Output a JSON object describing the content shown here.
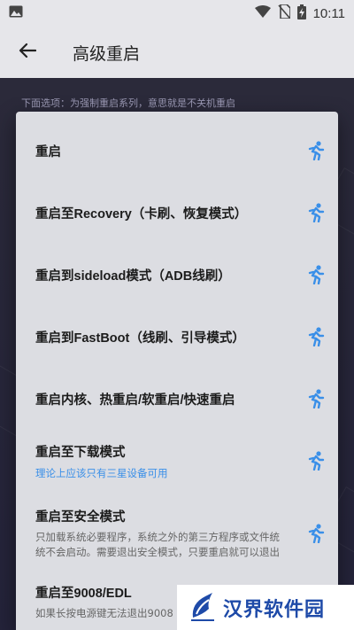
{
  "status_bar": {
    "time": "10:11"
  },
  "app_bar": {
    "title": "高级重启"
  },
  "background": {
    "hint": "下面选项：为强制重启系列，意思就是不关机重启"
  },
  "dialog": {
    "items": [
      {
        "title": "重启",
        "subtitle": ""
      },
      {
        "title": "重启至Recovery（卡刷、恢复模式）",
        "subtitle": ""
      },
      {
        "title": "重启到sideload模式（ADB线刷）",
        "subtitle": ""
      },
      {
        "title": "重启到FastBoot（线刷、引导模式）",
        "subtitle": ""
      },
      {
        "title": "重启内核、热重启/软重启/快速重启",
        "subtitle": ""
      },
      {
        "title": "重启至下载模式",
        "subtitle": "理论上应该只有三星设备可用"
      },
      {
        "title": "重启至安全模式",
        "subtitle": "只加载系统必要程序，系统之外的第三方程序或文件统统不会启动。需要退出安全模式，只要重启就可以退出"
      },
      {
        "title": "重启至9008/EDL",
        "subtitle": "如果长按电源键无法退出9008"
      }
    ]
  },
  "watermark": {
    "text": "汉界软件园"
  },
  "colors": {
    "accent": "#3a8fe8",
    "dialog_bg": "#dcdde2",
    "app_bar_bg": "#e6e6ea"
  }
}
